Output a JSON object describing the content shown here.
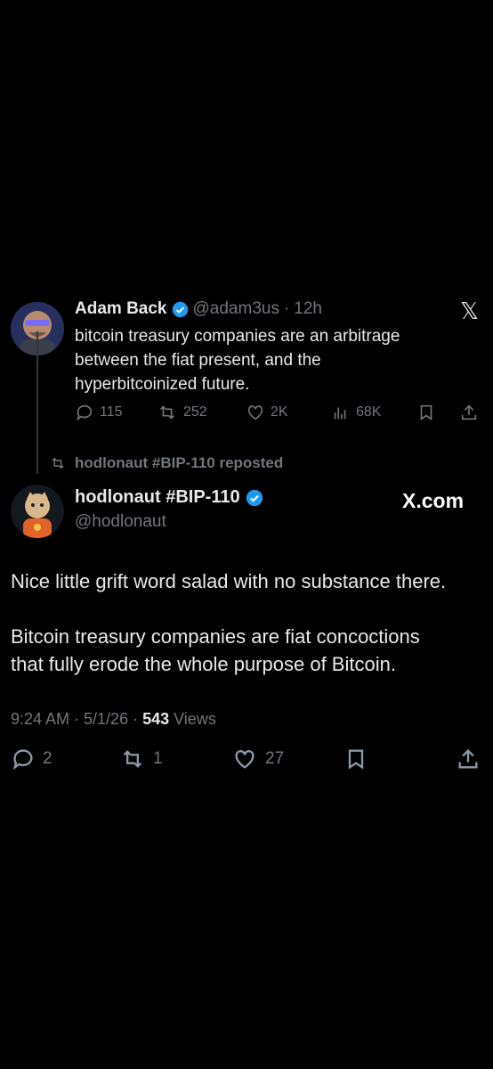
{
  "quoted_tweet": {
    "author_name": "Adam Back",
    "handle": "@adam3us",
    "separator": "·",
    "time": "12h",
    "text_lines": [
      "bitcoin treasury companies are an arbitrage",
      "between the fiat present, and the",
      "hyperbitcoinized future."
    ],
    "metrics": {
      "replies": "115",
      "reposts": "252",
      "likes": "2K",
      "views": "68K"
    }
  },
  "repost_banner": {
    "text": "hodlonaut #BIP-110 reposted"
  },
  "main_tweet": {
    "author_name": "hodlonaut #BIP-110",
    "handle": "@hodlonaut",
    "paragraphs": [
      "Nice little grift word salad with no substance there.",
      "Bitcoin treasury companies are fiat concoctions",
      "that fully erode the whole purpose of Bitcoin."
    ],
    "timestamp": "9:24 AM · 5/1/26 · ",
    "views_count": "543",
    "views_label": " Views",
    "metrics": {
      "replies": "2",
      "reposts": "1",
      "likes": "27"
    }
  },
  "branding": {
    "x_logo": "𝕏",
    "watermark": "X.com"
  },
  "colors": {
    "background": "#000000",
    "text": "#e7e9ea",
    "muted": "#71767b",
    "verified": "#1d9bf0"
  }
}
